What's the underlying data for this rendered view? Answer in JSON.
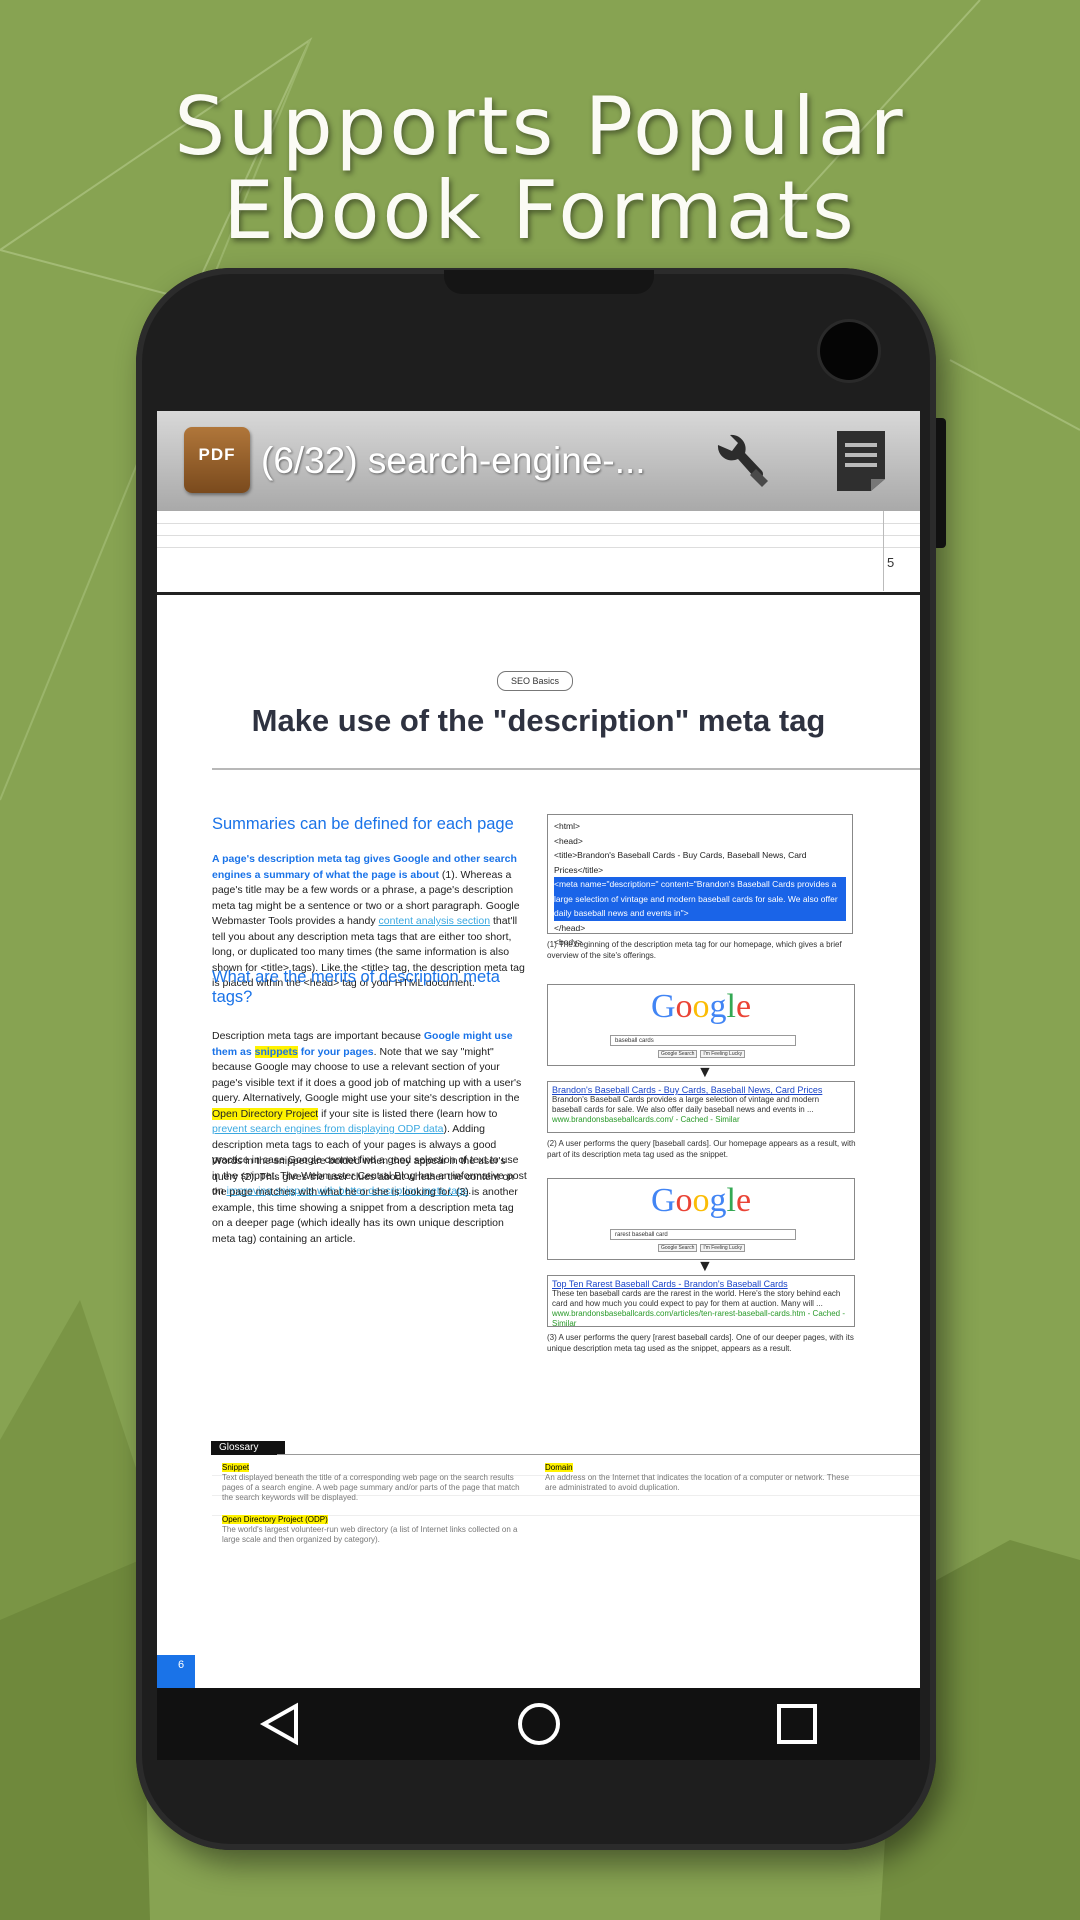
{
  "promo": {
    "headline_line1": "Supports Popular",
    "headline_line2": "Ebook Formats"
  },
  "app": {
    "icon_label": "PDF",
    "title": "(6/32) search-engine-...",
    "actions": [
      "wrench-icon",
      "document-icon"
    ]
  },
  "previous_page": {
    "row_number": "5"
  },
  "document": {
    "badge": "SEO Basics",
    "title": "Make use of the \"description\" meta tag",
    "section1": {
      "heading": "Summaries can be defined for each page",
      "lead_bold": "A page's description meta tag gives Google and other search engines a summary of what the page is about",
      "text_a": " (1). Whereas a page's title may be a few words or a phrase, a page's description meta tag might be a sentence or two or a short paragraph. Google Webmaster Tools provides a handy ",
      "link": "content analysis section",
      "text_b": " that'll tell you about any description meta tags that are either too short, long, or duplicated too many times (the same information is also shown for <title> tags). Like the <title> tag, the description meta tag is placed within the <head> tag of your HTML document."
    },
    "section2": {
      "heading": "What are the merits of description meta tags?",
      "text_a": "Description meta tags are important because ",
      "bold_a": "Google might use them as ",
      "hl_snippets": "snippets",
      "bold_b": " for your pages",
      "text_b": ". Note that we say \"might\" because Google may choose to use a relevant section of your page's visible text if it does a good job of matching up with a user's query. Alternatively, Google might use your site's description in the ",
      "hl_odp": "Open Directory Project",
      "text_c": " if your site is listed there (learn how to ",
      "link_a": "prevent search engines from displaying ODP data",
      "text_d": "). Adding description meta tags to each of your pages is always a good practice in case Google cannot find a good selection of text to use in the snippet. The Webmaster Central Blog has an informative post on ",
      "link_b": "improving snippets with better description meta tags",
      "text_e": "."
    },
    "section3": {
      "text": "Words in the snippet are bolded when they appear in the user's query (2). This gives the user clues about whether the content on the page matches with what he or she is looking for. (3) is another example, this time showing a snippet from a description meta tag on a deeper page (which ideally has its own unique description meta tag) containing an article."
    },
    "code_example": {
      "line1": "<html>",
      "line2": "<head>",
      "line3": "<title>Brandon's Baseball Cards - Buy Cards, Baseball News, Card Prices</title>",
      "selected": "<meta name=\"description=\" content=\"Brandon's Baseball Cards provides a large selection of vintage and modern baseball cards for sale. We also offer daily baseball news and events in\">",
      "line5": "</head>",
      "line6": "<body>",
      "caption": "(1) The beginning of the description meta tag for our homepage, which gives a brief overview of the site's offerings."
    },
    "search1": {
      "logo": "Google",
      "query": "baseball cards",
      "btn1": "Google Search",
      "btn2": "I'm Feeling Lucky",
      "result_title": "Brandon's Baseball Cards - Buy Cards, Baseball News, Card Prices",
      "result_text": "Brandon's Baseball Cards provides a large selection of vintage and modern baseball cards for sale. We also offer daily baseball news and events in ...",
      "result_url": "www.brandonsbaseballcards.com/ - Cached - Similar",
      "caption": "(2) A user performs the query [baseball cards]. Our homepage appears as a result, with part of its description meta tag used as the snippet."
    },
    "search2": {
      "logo": "Google",
      "query": "rarest baseball card",
      "btn1": "Google Search",
      "btn2": "I'm Feeling Lucky",
      "result_title": "Top Ten Rarest Baseball Cards - Brandon's Baseball Cards",
      "result_text": "These ten baseball cards are the rarest in the world. Here's the story behind each card and how much you could expect to pay for them at auction. Many will ...",
      "result_url": "www.brandonsbaseballcards.com/articles/ten-rarest-baseball-cards.htm - Cached - Similar",
      "caption": "(3) A user performs the query [rarest baseball cards]. One of our deeper pages, with its unique description meta tag used as the snippet, appears as a result."
    },
    "glossary": {
      "label": "Glossary",
      "term1": "Snippet",
      "def1": "Text displayed beneath the title of a corresponding web page on the search results pages of a search engine. A web page summary and/or parts of the page that match the search keywords will be displayed.",
      "term2": "Domain",
      "def2": "An address on the Internet that indicates the location of a computer or network. These are administrated to avoid duplication.",
      "term3": "Open Directory Project (ODP)",
      "def3": "The world's largest volunteer-run web directory (a list of Internet links collected on a large scale and then organized by category)."
    },
    "page_number": "6"
  },
  "navbar": {
    "buttons": [
      "back-icon",
      "home-icon",
      "recents-icon"
    ]
  },
  "colors": {
    "background": "#87a352",
    "link_blue": "#1a73e8",
    "highlight": "#fff200"
  }
}
